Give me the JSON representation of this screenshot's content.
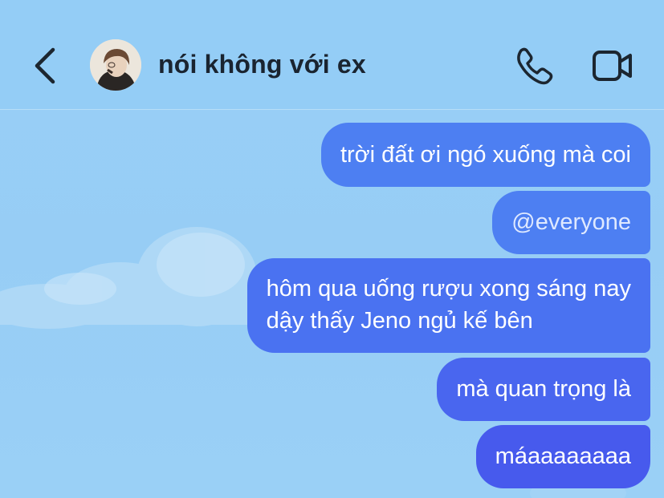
{
  "header": {
    "title": "nói không với ex",
    "back_icon": "chevron-left-icon",
    "call_icon": "phone-icon",
    "video_icon": "video-camera-icon"
  },
  "messages": [
    {
      "sender": "me",
      "lines": [
        "trời đất ơi ngó xuống mà coi"
      ]
    },
    {
      "sender": "me",
      "lines": [
        "@everyone"
      ]
    },
    {
      "sender": "me",
      "lines": [
        "hôm qua uống rượu xong sáng nay",
        "dậy thấy Jeno ngủ kế bên"
      ]
    },
    {
      "sender": "me",
      "lines": [
        "mà quan trọng là"
      ]
    },
    {
      "sender": "me",
      "lines": [
        "máaaaaaaaa"
      ]
    }
  ],
  "colors": {
    "background": "#97cdf5",
    "header_text": "#1a2430",
    "bubble_top": "#4d7ff2",
    "bubble_bottom": "#475aed",
    "bubble_text": "#ffffff"
  }
}
